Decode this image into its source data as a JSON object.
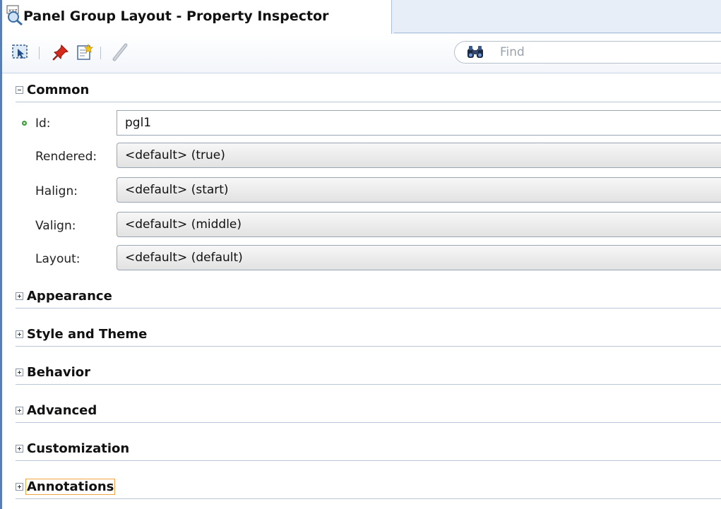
{
  "window": {
    "title": "Panel Group Layout - Property Inspector"
  },
  "toolbar": {
    "icons": [
      "select-component-icon",
      "pin-icon",
      "edit-icon",
      "pencil-icon"
    ],
    "find_placeholder": "Find"
  },
  "sections": {
    "common": {
      "label": "Common",
      "expanded": true
    },
    "appearance": {
      "label": "Appearance",
      "expanded": false
    },
    "style_theme": {
      "label": "Style and Theme",
      "expanded": false
    },
    "behavior": {
      "label": "Behavior",
      "expanded": false
    },
    "advanced": {
      "label": "Advanced",
      "expanded": false
    },
    "customization": {
      "label": "Customization",
      "expanded": false
    },
    "annotations": {
      "label": "Annotations",
      "expanded": false
    }
  },
  "properties": {
    "id": {
      "label": "Id:",
      "value": "pgl1",
      "required": true
    },
    "rendered": {
      "label": "Rendered:",
      "value": "<default> (true)"
    },
    "halign": {
      "label": "Halign:",
      "value": "<default> (start)"
    },
    "valign": {
      "label": "Valign:",
      "value": "<default> (middle)"
    },
    "layout": {
      "label": "Layout:",
      "value": "<default> (default)"
    }
  },
  "colors": {
    "border_accent": "#5a7fb8",
    "required_indicator": "#3c9a3c",
    "focus_outline": "#f0a540"
  }
}
